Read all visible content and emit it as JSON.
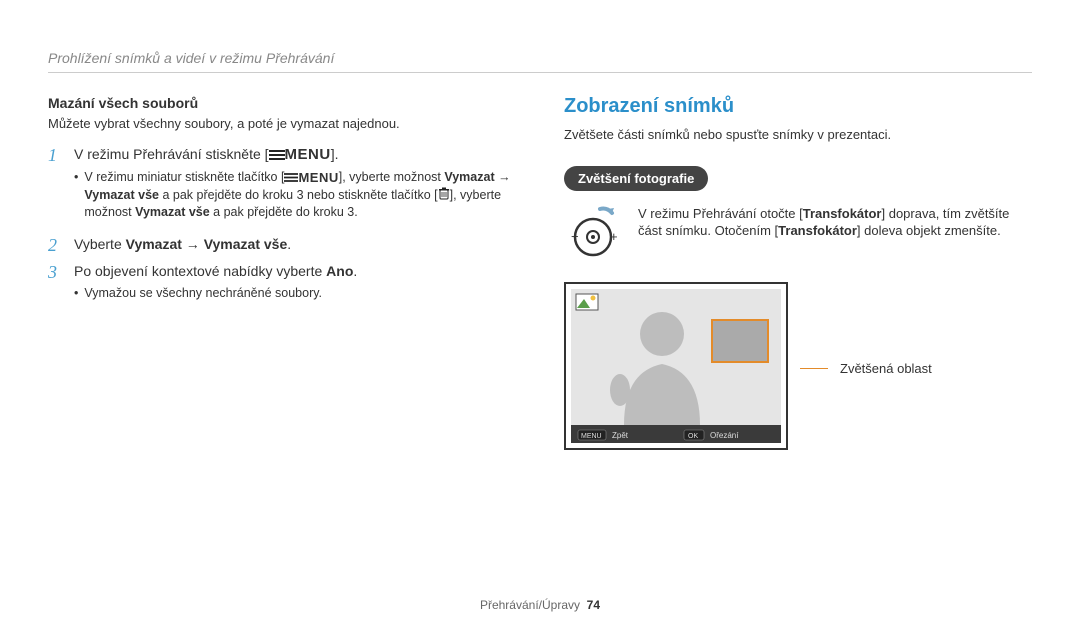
{
  "breadcrumb": "Prohlížení snímků a videí v režimu Přehrávání",
  "left": {
    "section_title": "Mazání všech souborů",
    "intro": "Můžete vybrat všechny soubory, a poté je vymazat najednou.",
    "step1_pre": "V režimu Přehrávání stiskněte [",
    "step1_post": "].",
    "menu_label": "MENU",
    "sub1_a": "V režimu miniatur stiskněte tlačítko [",
    "sub1_b": "], vyberte možnost ",
    "sub1_bold1": "Vymazat",
    "sub1_c": " → ",
    "sub1_bold2": "Vymazat vše",
    "sub1_d": " a pak přejděte do kroku 3 nebo stiskněte tlačítko [",
    "sub1_e": "], vyberte možnost ",
    "sub1_bold3": "Vymazat vše",
    "sub1_f": " a pak přejděte do kroku 3.",
    "step2_a": "Vyberte ",
    "step2_bold1": "Vymazat",
    "step2_b": " → ",
    "step2_bold2": "Vymazat vše",
    "step2_c": ".",
    "step3_a": "Po objevení kontextové nabídky vyberte ",
    "step3_bold": "Ano",
    "step3_b": ".",
    "sub3": "Vymažou se všechny nechráněné soubory."
  },
  "right": {
    "heading": "Zobrazení snímků",
    "intro": "Zvětšete části snímků nebo spusťte snímky v prezentaci.",
    "pill": "Zvětšení fotografie",
    "zoom_a": "V režimu Přehrávání otočte [",
    "zoom_bold1": "Transfokátor",
    "zoom_b": "] doprava, tím zvětšíte část snímku. Otočením [",
    "zoom_bold2": "Transfokátor",
    "zoom_c": "] doleva objekt zmenšíte.",
    "region_label": "Zvětšená oblast",
    "screen_back": "Zpět",
    "screen_crop": "Ořezání",
    "screen_menu": "MENU",
    "screen_ok": "OK"
  },
  "footer": {
    "section": "Přehrávání/Úpravy",
    "page": "74"
  }
}
